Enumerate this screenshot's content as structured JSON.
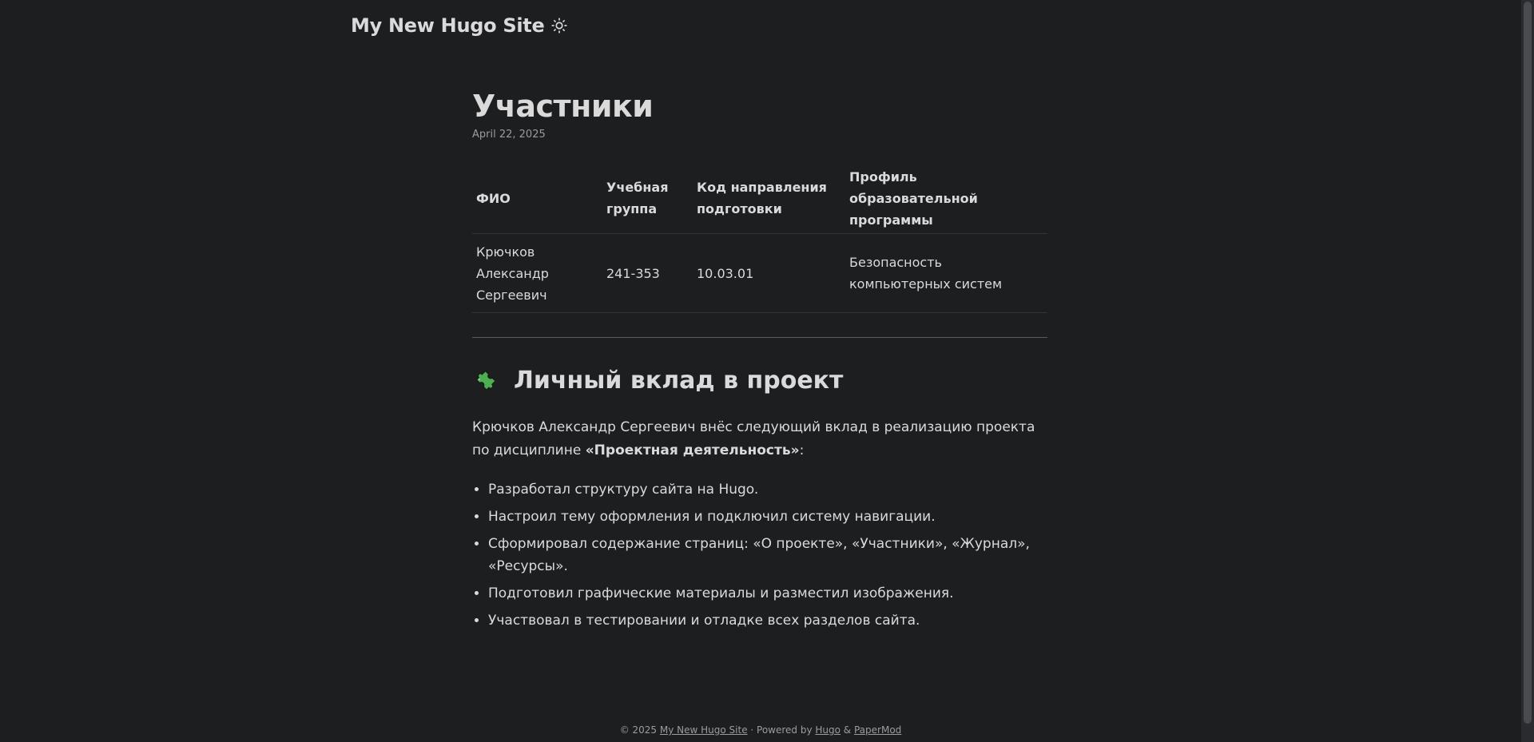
{
  "header": {
    "site_title": "My New Hugo Site",
    "theme_toggle_icon": "sun-icon"
  },
  "post": {
    "title": "Участники",
    "date": "April 22, 2025"
  },
  "table": {
    "headers": [
      "ФИО",
      "Учебная группа",
      "Код направления подготовки",
      "Профиль образовательной программы"
    ],
    "rows": [
      [
        "Крючков Александр Сергеевич",
        "241-353",
        "10.03.01",
        "Безопасность компьютерных систем"
      ]
    ]
  },
  "contribution": {
    "icon": "puzzle-piece-icon",
    "heading": "Личный вклад в проект",
    "intro_text": "Крючков Александр Сергеевич внёс следующий вклад в реализацию проекта по дисциплине ",
    "intro_bold": "«Проектная деятельность»",
    "intro_end": ":",
    "items": [
      "Разработал структуру сайта на Hugo.",
      "Настроил тему оформления и подключил систему навигации.",
      "Сформировал содержание страниц: «О проекте», «Участники», «Журнал», «Ресурсы».",
      "Подготовил графические материалы и разместил изображения.",
      "Участвовал в тестировании и отладке всех разделов сайта."
    ]
  },
  "footer": {
    "copyright": "© 2025 ",
    "site_link": "My New Hugo Site",
    "powered_by": " · Powered by ",
    "hugo_link": "Hugo",
    "amp": " & ",
    "theme_link": "PaperMod"
  },
  "colors": {
    "background": "#1d1e20",
    "text": "#dadadb",
    "secondary": "#9b9c9d",
    "border": "#333437"
  }
}
